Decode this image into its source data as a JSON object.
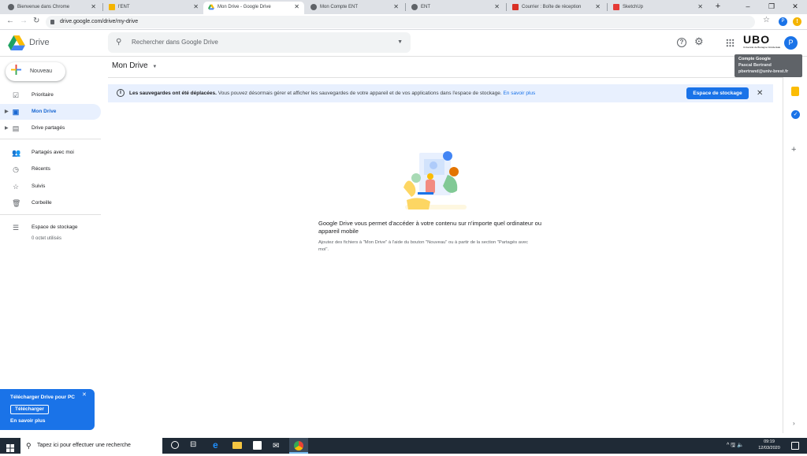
{
  "browser": {
    "tabs": [
      {
        "title": "Bienvenue dans Chrome",
        "active": false
      },
      {
        "title": "l'ENT",
        "active": false
      },
      {
        "title": "Mon Drive - Google Drive",
        "active": true
      },
      {
        "title": "Mon Compte ENT",
        "active": false
      },
      {
        "title": "ENT",
        "active": false
      },
      {
        "title": "Courrier : Boîte de réception",
        "active": false
      },
      {
        "title": "SketchUp",
        "active": false
      }
    ],
    "url": "drive.google.com/drive/my-drive",
    "profile_initial": "P"
  },
  "header": {
    "app_name": "Drive",
    "search_placeholder": "Rechercher dans Google Drive",
    "org_logo_text": "UBO",
    "org_logo_sub": "Université de Bretagne Occidentale",
    "avatar_initial": "P",
    "tooltip": {
      "title": "Compte Google",
      "name": "Pascal Bertrand",
      "email": "pbertrand@univ-brest.fr"
    }
  },
  "sidebar": {
    "new_button": "Nouveau",
    "items": [
      {
        "label": "Prioritaire",
        "icon": "priority-icon"
      },
      {
        "label": "Mon Drive",
        "icon": "my-drive-icon",
        "active": true
      },
      {
        "label": "Drive partagés",
        "icon": "shared-drives-icon"
      },
      {
        "label": "Partagés avec moi",
        "icon": "shared-with-me-icon"
      },
      {
        "label": "Récents",
        "icon": "clock-icon"
      },
      {
        "label": "Suivis",
        "icon": "star-icon"
      },
      {
        "label": "Corbeille",
        "icon": "trash-icon"
      }
    ],
    "storage_label": "Espace de stockage",
    "storage_usage": "0 octet utilisés"
  },
  "main": {
    "title": "Mon Drive",
    "banner_bold": "Les sauvegardes ont été déplacées.",
    "banner_text": "Vous pouvez désormais gérer et afficher les sauvegardes de votre appareil et de vos applications dans l'espace de stockage.",
    "banner_link": "En savoir plus",
    "banner_button": "Espace de stockage",
    "empty_title": "Google Drive vous permet d'accéder à votre contenu sur n'importe quel ordinateur ou appareil mobile",
    "empty_subtitle": "Ajoutez des fichiers à \"Mon Drive\" à l'aide du bouton \"Nouveau\" ou à partir de la section \"Partagés avec moi\"."
  },
  "promo": {
    "title": "Télécharger Drive pour PC",
    "button": "Télécharger",
    "link": "En savoir plus"
  },
  "taskbar": {
    "search_placeholder": "Tapez ici pour effectuer une recherche",
    "time": "09:19",
    "date": "12/03/2020"
  },
  "colors": {
    "accent": "#1a73e8",
    "banner_bg": "#e8f0fe",
    "taskbar": "#1f2a36"
  }
}
